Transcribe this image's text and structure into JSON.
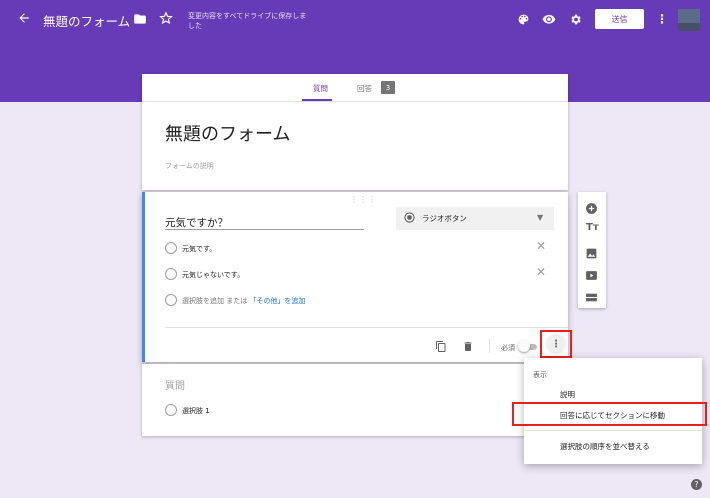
{
  "header": {
    "title": "無題のフォーム",
    "save_status": "変更内容をすべてドライブに保存しました",
    "send_label": "送信"
  },
  "tabs": [
    {
      "label": "質問",
      "active": true
    },
    {
      "label": "回答",
      "active": false,
      "badge": "3"
    }
  ],
  "form": {
    "title": "無題のフォーム",
    "description_placeholder": "フォームの説明"
  },
  "question": {
    "title": "元気ですか？",
    "type": "ラジオボタン",
    "options": [
      "元気です。",
      "元気じゃないです。"
    ],
    "add_option": "選択肢を追加",
    "or_text": "または",
    "add_other": "「その他」を追加",
    "required_label": "必須"
  },
  "question2": {
    "title": "質問",
    "option": "選択肢 1"
  },
  "menu": {
    "header": "表示",
    "items": [
      "説明",
      "回答に応じてセクションに移動",
      "選択肢の順序を並べ替える"
    ]
  },
  "colors": {
    "primary": "#673ab7",
    "background": "#ede7f6",
    "highlight": "#e52020",
    "link": "#1a73e8"
  }
}
